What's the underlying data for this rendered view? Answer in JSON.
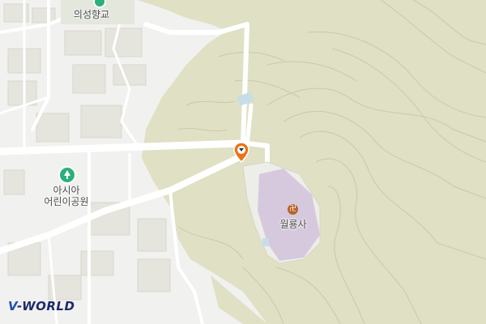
{
  "map": {
    "labels": {
      "school": "의성향교",
      "park_line1": "아시아",
      "park_line2": "어린이공원",
      "temple": "월룡사"
    },
    "icons": {
      "school": "school-poi-icon",
      "park": "park-poi-icon",
      "temple": "temple-poi-icon",
      "marker": "location-marker-icon"
    },
    "logo": {
      "prefix": "V",
      "suffix": "-WORLD"
    },
    "colors": {
      "background": "#f1f1ef",
      "terrain": "#dfe0c4",
      "road": "#ffffff",
      "building": "#e5e4dd",
      "temple_area": "#d7c9dd",
      "contour": "#c9caab",
      "marker": "#e8731a",
      "park_icon": "#2bb07a",
      "temple_icon": "#b5652b"
    }
  }
}
